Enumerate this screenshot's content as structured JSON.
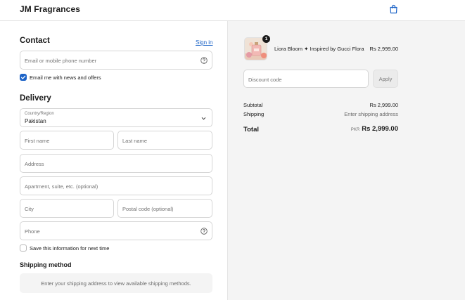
{
  "header": {
    "brand": "JM Fragrances",
    "cart_icon": "shopping-bag-icon"
  },
  "contact": {
    "heading": "Contact",
    "sign_in": "Sign in",
    "email_placeholder": "Email or mobile phone number",
    "newsletter_label": "Email me with news and offers",
    "newsletter_checked": true
  },
  "delivery": {
    "heading": "Delivery",
    "country_label": "Country/Region",
    "country_value": "Pakistan",
    "first_name_placeholder": "First name",
    "last_name_placeholder": "Last name",
    "address_placeholder": "Address",
    "apartment_placeholder": "Apartment, suite, etc. (optional)",
    "city_placeholder": "City",
    "postal_placeholder": "Postal code (optional)",
    "phone_placeholder": "Phone",
    "save_info_label": "Save this information for next time",
    "save_info_checked": false
  },
  "shipping": {
    "heading": "Shipping method",
    "message": "Enter your shipping address to view available shipping methods."
  },
  "order": {
    "product_name": "Liora Bloom ✦ Inspired by Gucci Flora",
    "product_price": "Rs 2,999.00",
    "quantity": "1",
    "discount_placeholder": "Discount code",
    "apply_label": "Apply",
    "subtotal_label": "Subtotal",
    "subtotal_value": "Rs 2,999.00",
    "shipping_label": "Shipping",
    "shipping_value": "Enter shipping address",
    "total_label": "Total",
    "total_currency": "PKR",
    "total_value": "Rs 2,999.00"
  },
  "colors": {
    "accent": "#1c63c7",
    "summary_bg": "#f4f4f4",
    "border": "#d6d6d6"
  }
}
